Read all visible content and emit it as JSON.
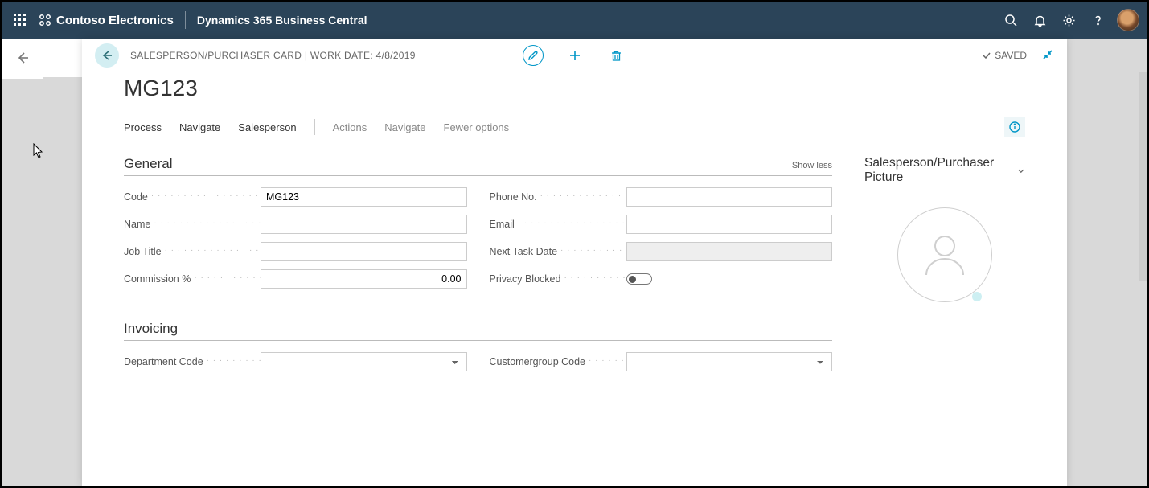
{
  "topnav": {
    "company": "Contoso Electronics",
    "app": "Dynamics 365 Business Central"
  },
  "card": {
    "breadcrumb": "SALESPERSON/PURCHASER CARD | WORK DATE: 4/8/2019",
    "title": "MG123",
    "saved": "SAVED"
  },
  "actionbar": {
    "process": "Process",
    "navigate1": "Navigate",
    "salesperson": "Salesperson",
    "actions": "Actions",
    "navigate2": "Navigate",
    "fewer": "Fewer options"
  },
  "general": {
    "heading": "General",
    "show_less": "Show less",
    "labels": {
      "code": "Code",
      "name": "Name",
      "job_title": "Job Title",
      "commission": "Commission %",
      "phone": "Phone No.",
      "email": "Email",
      "next_task": "Next Task Date",
      "privacy": "Privacy Blocked"
    },
    "values": {
      "code": "MG123",
      "name": "",
      "job_title": "",
      "commission": "0.00",
      "phone": "",
      "email": "",
      "next_task": "",
      "privacy_blocked": false
    }
  },
  "invoicing": {
    "heading": "Invoicing",
    "labels": {
      "department": "Department Code",
      "customergroup": "Customergroup Code"
    },
    "values": {
      "department": "",
      "customergroup": ""
    }
  },
  "side": {
    "picture_heading": "Salesperson/Purchaser Picture"
  }
}
